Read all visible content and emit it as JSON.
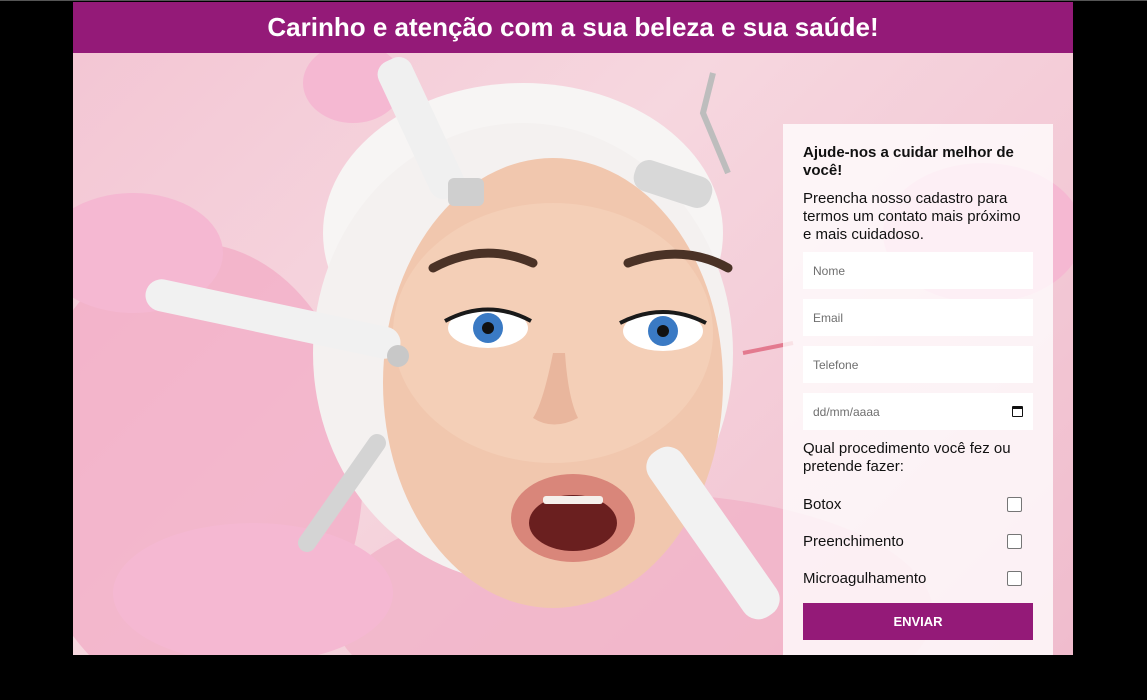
{
  "header": {
    "title": "Carinho e atenção com a sua beleza e sua saúde!"
  },
  "hero": {
    "image": "woman-face-aesthetic-treatment"
  },
  "form": {
    "heading": "Ajude-nos a cuidar melhor de você!",
    "intro": "Preencha nosso cadastro para termos um contato mais próximo e mais cuidadoso.",
    "fields": {
      "name_placeholder": "Nome",
      "email_placeholder": "Email",
      "phone_placeholder": "Telefone",
      "date_placeholder": "dd/mm/aaaa"
    },
    "question": "Qual procedimento você fez ou pretende fazer:",
    "options": [
      {
        "label": "Botox",
        "checked": false
      },
      {
        "label": "Preenchimento",
        "checked": false
      },
      {
        "label": "Microagulhamento",
        "checked": false
      }
    ],
    "submit_label": "ENVIAR"
  },
  "colors": {
    "brand": "#941a78",
    "page_bg": "#000000"
  }
}
